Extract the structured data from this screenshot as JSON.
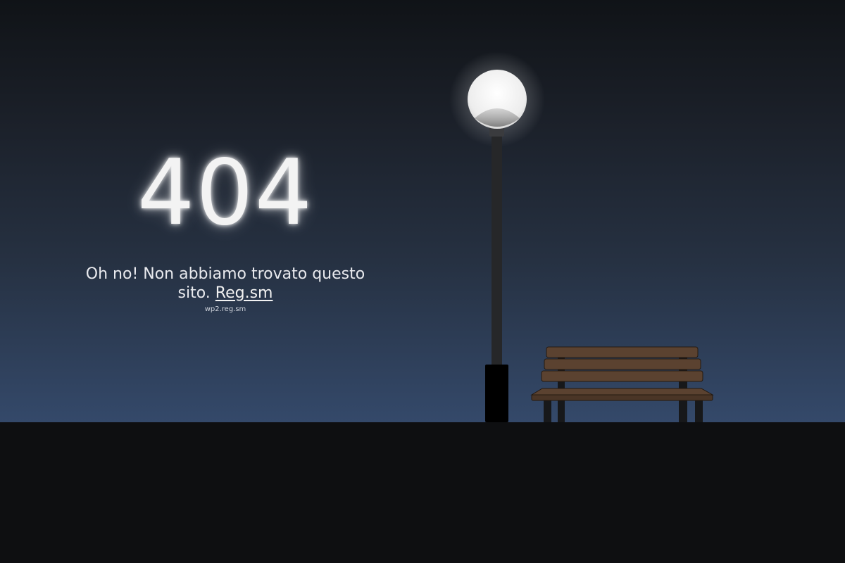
{
  "error": {
    "code": "404",
    "message_prefix": "Oh no! Non abbiamo trovato questo sito.",
    "link_label": "Reg.sm",
    "hostname": "wp2.reg.sm"
  },
  "colors": {
    "sky_top": "#101317",
    "sky_bottom": "#34496a",
    "ground": "#0e0f11",
    "bench_wood": "#5b4230",
    "lamp_glow": "#f4f4f4"
  },
  "icons": {
    "lamp": "street-lamp-icon",
    "bench": "park-bench-icon"
  }
}
